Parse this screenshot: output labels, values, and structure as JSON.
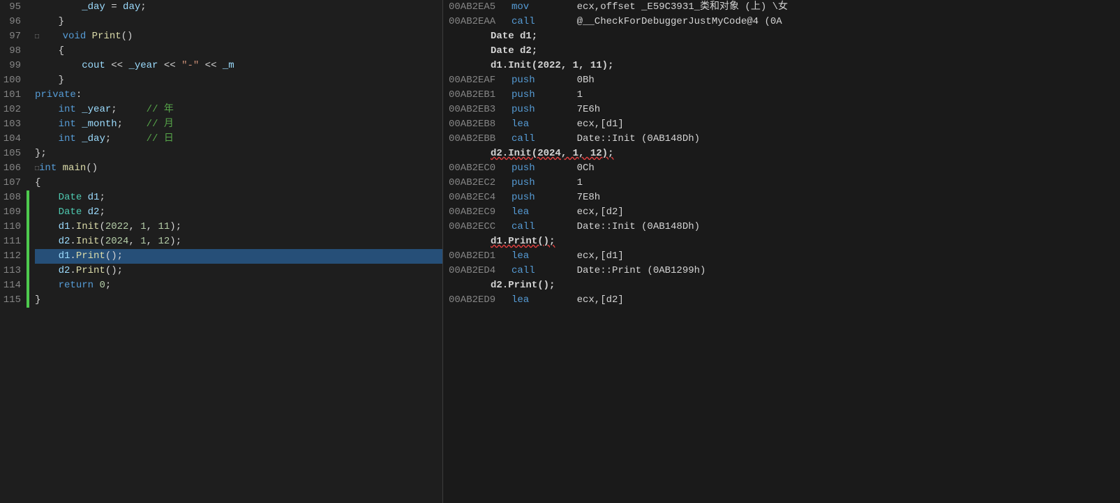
{
  "leftPanel": {
    "lines": [
      {
        "num": 95,
        "green": false,
        "indent": 2,
        "tokens": [
          {
            "t": "plain",
            "v": "        "
          },
          {
            "t": "var",
            "v": "_day"
          },
          {
            "t": "plain",
            "v": " = "
          },
          {
            "t": "var",
            "v": "day"
          },
          {
            "t": "plain",
            "v": ";"
          }
        ]
      },
      {
        "num": 96,
        "green": false,
        "indent": 2,
        "tokens": [
          {
            "t": "plain",
            "v": "    }"
          }
        ]
      },
      {
        "num": 97,
        "green": false,
        "indent": 1,
        "tokens": [
          {
            "t": "box",
            "v": "□"
          },
          {
            "t": "plain",
            "v": "    "
          },
          {
            "t": "kw",
            "v": "void"
          },
          {
            "t": "plain",
            "v": " "
          },
          {
            "t": "fn",
            "v": "Print"
          },
          {
            "t": "plain",
            "v": "()"
          }
        ]
      },
      {
        "num": 98,
        "green": false,
        "tokens": [
          {
            "t": "plain",
            "v": "    {"
          }
        ]
      },
      {
        "num": 99,
        "green": false,
        "tokens": [
          {
            "t": "plain",
            "v": "        "
          },
          {
            "t": "var",
            "v": "cout"
          },
          {
            "t": "plain",
            "v": " << "
          },
          {
            "t": "var",
            "v": "_year"
          },
          {
            "t": "plain",
            "v": " << "
          },
          {
            "t": "str",
            "v": "\"-\""
          },
          {
            "t": "plain",
            "v": " << "
          },
          {
            "t": "var",
            "v": "_m"
          }
        ]
      },
      {
        "num": 100,
        "green": false,
        "tokens": [
          {
            "t": "plain",
            "v": "    }"
          }
        ]
      },
      {
        "num": 101,
        "green": false,
        "tokens": [
          {
            "t": "kw",
            "v": "private"
          },
          {
            "t": "plain",
            "v": ":"
          }
        ]
      },
      {
        "num": 102,
        "green": false,
        "tokens": [
          {
            "t": "plain",
            "v": "    "
          },
          {
            "t": "kw",
            "v": "int"
          },
          {
            "t": "plain",
            "v": " "
          },
          {
            "t": "var",
            "v": "_year"
          },
          {
            "t": "plain",
            "v": ";     "
          },
          {
            "t": "comment",
            "v": "// 年"
          }
        ]
      },
      {
        "num": 103,
        "green": false,
        "tokens": [
          {
            "t": "plain",
            "v": "    "
          },
          {
            "t": "kw",
            "v": "int"
          },
          {
            "t": "plain",
            "v": " "
          },
          {
            "t": "var",
            "v": "_month"
          },
          {
            "t": "plain",
            "v": ";    "
          },
          {
            "t": "comment",
            "v": "// 月"
          }
        ]
      },
      {
        "num": 104,
        "green": false,
        "tokens": [
          {
            "t": "plain",
            "v": "    "
          },
          {
            "t": "kw",
            "v": "int"
          },
          {
            "t": "plain",
            "v": " "
          },
          {
            "t": "var",
            "v": "_day"
          },
          {
            "t": "plain",
            "v": ";      "
          },
          {
            "t": "comment",
            "v": "// 日"
          }
        ]
      },
      {
        "num": 105,
        "green": false,
        "tokens": [
          {
            "t": "plain",
            "v": "};"
          }
        ]
      },
      {
        "num": 106,
        "green": false,
        "tokens": [
          {
            "t": "box",
            "v": "□"
          },
          {
            "t": "kw",
            "v": "int"
          },
          {
            "t": "plain",
            "v": " "
          },
          {
            "t": "fn",
            "v": "main"
          },
          {
            "t": "plain",
            "v": "()"
          }
        ]
      },
      {
        "num": 107,
        "green": false,
        "tokens": [
          {
            "t": "plain",
            "v": "{"
          }
        ]
      },
      {
        "num": 108,
        "green": true,
        "tokens": [
          {
            "t": "plain",
            "v": "    "
          },
          {
            "t": "green-text",
            "v": "Date"
          },
          {
            "t": "plain",
            "v": " "
          },
          {
            "t": "var",
            "v": "d1"
          },
          {
            "t": "plain",
            "v": ";"
          }
        ]
      },
      {
        "num": 109,
        "green": true,
        "tokens": [
          {
            "t": "plain",
            "v": "    "
          },
          {
            "t": "green-text",
            "v": "Date"
          },
          {
            "t": "plain",
            "v": " "
          },
          {
            "t": "var",
            "v": "d2"
          },
          {
            "t": "plain",
            "v": ";"
          }
        ]
      },
      {
        "num": 110,
        "green": true,
        "tokens": [
          {
            "t": "plain",
            "v": "    "
          },
          {
            "t": "var",
            "v": "d1"
          },
          {
            "t": "plain",
            "v": "."
          },
          {
            "t": "fn",
            "v": "Init"
          },
          {
            "t": "plain",
            "v": "("
          },
          {
            "t": "num",
            "v": "2022"
          },
          {
            "t": "plain",
            "v": ", "
          },
          {
            "t": "num",
            "v": "1"
          },
          {
            "t": "plain",
            "v": ", "
          },
          {
            "t": "num",
            "v": "11"
          },
          {
            "t": "plain",
            "v": ");"
          }
        ]
      },
      {
        "num": 111,
        "green": true,
        "tokens": [
          {
            "t": "plain",
            "v": "    "
          },
          {
            "t": "var",
            "v": "d2"
          },
          {
            "t": "plain",
            "v": "."
          },
          {
            "t": "fn",
            "v": "Init"
          },
          {
            "t": "plain",
            "v": "("
          },
          {
            "t": "num",
            "v": "2024"
          },
          {
            "t": "plain",
            "v": ", "
          },
          {
            "t": "num",
            "v": "1"
          },
          {
            "t": "plain",
            "v": ", "
          },
          {
            "t": "num",
            "v": "12"
          },
          {
            "t": "plain",
            "v": ");"
          }
        ]
      },
      {
        "num": 112,
        "green": true,
        "selected": true,
        "tokens": [
          {
            "t": "plain",
            "v": "    "
          },
          {
            "t": "var",
            "v": "d1"
          },
          {
            "t": "plain",
            "v": "."
          },
          {
            "t": "fn",
            "v": "Print"
          },
          {
            "t": "plain",
            "v": "();"
          }
        ]
      },
      {
        "num": 113,
        "green": true,
        "tokens": [
          {
            "t": "plain",
            "v": "    "
          },
          {
            "t": "var",
            "v": "d2"
          },
          {
            "t": "plain",
            "v": "."
          },
          {
            "t": "fn",
            "v": "Print"
          },
          {
            "t": "plain",
            "v": "();"
          }
        ]
      },
      {
        "num": 114,
        "green": true,
        "tokens": [
          {
            "t": "plain",
            "v": "    "
          },
          {
            "t": "kw",
            "v": "return"
          },
          {
            "t": "plain",
            "v": " "
          },
          {
            "t": "num",
            "v": "0"
          },
          {
            "t": "plain",
            "v": ";"
          }
        ]
      },
      {
        "num": 115,
        "green": true,
        "tokens": [
          {
            "t": "plain",
            "v": "}"
          }
        ]
      }
    ]
  },
  "rightPanel": {
    "rows": [
      {
        "type": "asm",
        "addr": "00AB2EA5",
        "mnem": "mov",
        "ops": "ecx,offset _E59C3931_类和对象 (上) \\女"
      },
      {
        "type": "asm",
        "addr": "00AB2EAA",
        "mnem": "call",
        "ops": "@__CheckForDebuggerJustMyCode@4 (0A"
      },
      {
        "type": "src",
        "code": "Date d1;"
      },
      {
        "type": "src",
        "code": "Date d2;"
      },
      {
        "type": "src",
        "code": "d1.Init(2022, 1, 11);"
      },
      {
        "type": "asm",
        "addr": "00AB2EAF",
        "mnem": "push",
        "ops": "0Bh"
      },
      {
        "type": "asm",
        "addr": "00AB2EB1",
        "mnem": "push",
        "ops": "1"
      },
      {
        "type": "asm",
        "addr": "00AB2EB3",
        "mnem": "push",
        "ops": "7E6h"
      },
      {
        "type": "asm",
        "addr": "00AB2EB8",
        "mnem": "lea",
        "ops": "ecx,[d1]"
      },
      {
        "type": "asm",
        "addr": "00AB2EBB",
        "mnem": "call",
        "ops": "Date::Init (0AB148Dh)"
      },
      {
        "type": "src",
        "code": "d2.Init(2024, 1, 12);",
        "redline": true
      },
      {
        "type": "asm",
        "addr": "00AB2EC0",
        "mnem": "push",
        "ops": "0Ch"
      },
      {
        "type": "asm",
        "addr": "00AB2EC2",
        "mnem": "push",
        "ops": "1"
      },
      {
        "type": "asm",
        "addr": "00AB2EC4",
        "mnem": "push",
        "ops": "7E8h"
      },
      {
        "type": "asm",
        "addr": "00AB2EC9",
        "mnem": "lea",
        "ops": "ecx,[d2]"
      },
      {
        "type": "asm",
        "addr": "00AB2ECC",
        "mnem": "call",
        "ops": "Date::Init (0AB148Dh)"
      },
      {
        "type": "src",
        "code": "d1.Print();",
        "redline": true
      },
      {
        "type": "asm",
        "addr": "00AB2ED1",
        "mnem": "lea",
        "ops": "ecx,[d1]"
      },
      {
        "type": "asm",
        "addr": "00AB2ED4",
        "mnem": "call",
        "ops": "Date::Print (0AB1299h)"
      },
      {
        "type": "src",
        "code": "d2.Print();"
      },
      {
        "type": "asm",
        "addr": "00AB2ED9",
        "mnem": "lea",
        "ops": "ecx,[d2]"
      }
    ]
  }
}
